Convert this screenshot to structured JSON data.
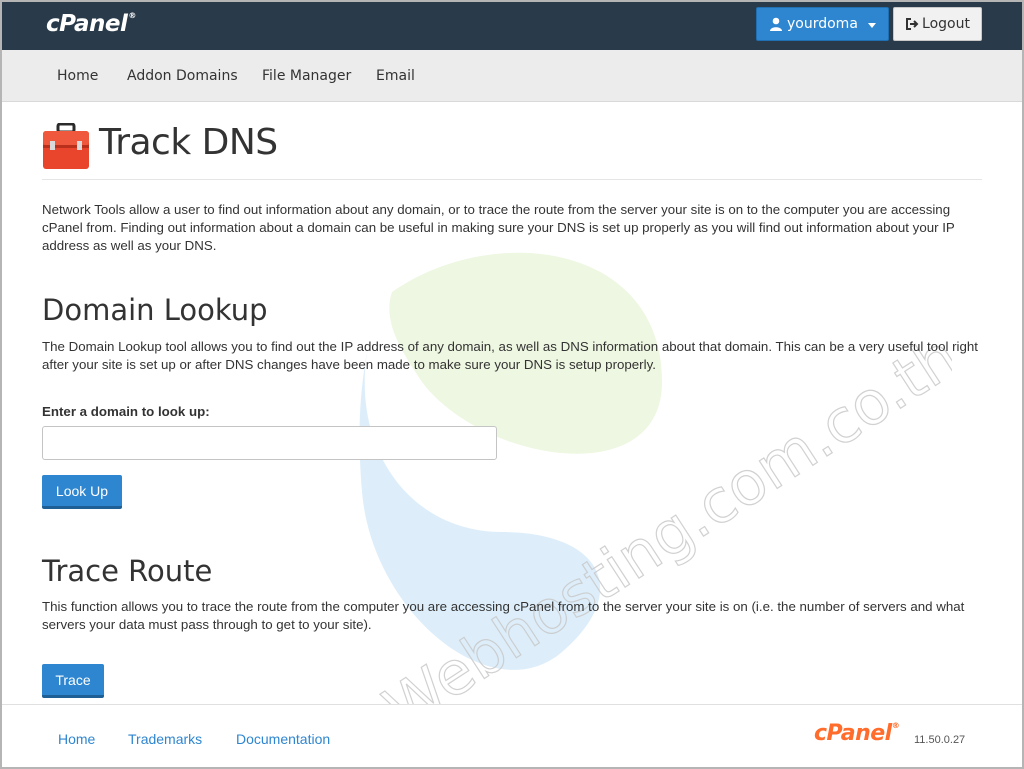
{
  "header": {
    "brand": "cPanel",
    "brand_mark": "®",
    "user_button": "yourdoma",
    "logout_button": "Logout"
  },
  "nav": {
    "items": [
      "Home",
      "Addon Domains",
      "File Manager",
      "Email"
    ]
  },
  "page": {
    "title": "Track DNS",
    "intro": "Network Tools allow a user to find out information about any domain, or to trace the route from the server your site is on to the computer you are accessing cPanel from. Finding out information about a domain can be useful in making sure your DNS is set up properly as you will find out information about your IP address as well as your DNS."
  },
  "domain_lookup": {
    "title": "Domain Lookup",
    "description": "The Domain Lookup tool allows you to find out the IP address of any domain, as well as DNS information about that domain. This can be a very useful tool right after your site is set up or after DNS changes have been made to make sure your DNS is setup properly.",
    "field_label": "Enter a domain to look up:",
    "input_value": "",
    "button": "Look Up"
  },
  "trace_route": {
    "title": "Trace Route",
    "description": "This function allows you to trace the route from the computer you are accessing cPanel from to the server your site is on (i.e. the number of servers and what servers your data must pass through to get to your site).",
    "button": "Trace"
  },
  "footer": {
    "links": [
      "Home",
      "Trademarks",
      "Documentation"
    ],
    "brand": "cPanel",
    "brand_mark": "®",
    "version": "11.50.0.27"
  },
  "watermark": {
    "text": "Webhosting.com.co.th"
  },
  "colors": {
    "topbar": "#293a4a",
    "accent": "#2e86d0",
    "footer_brand": "#ff6c2c",
    "icon_red": "#e8452c"
  }
}
